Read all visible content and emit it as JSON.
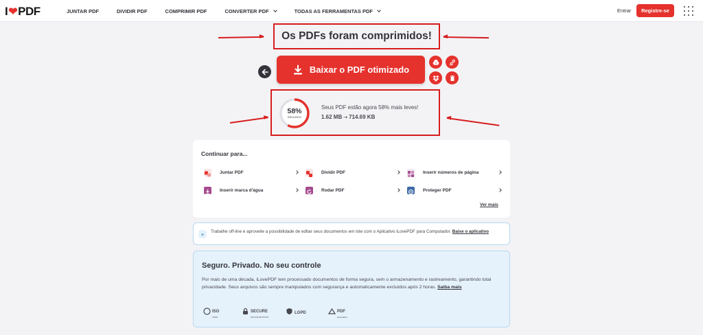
{
  "header": {
    "logo_prefix": "I",
    "logo_suffix": "PDF",
    "nav": [
      "JUNTAR PDF",
      "DIVIDIR PDF",
      "COMPRIMIR PDF",
      "CONVERTER PDF",
      "TODAS AS FERRAMENTAS PDF"
    ],
    "login": "Entrar",
    "signup": "Registre-se"
  },
  "result": {
    "title": "Os PDFs foram comprimidos!",
    "download_label": "Baixar o PDF otimizado"
  },
  "compression": {
    "percent_label": "58%",
    "percent_value": 58,
    "reduced_label": "REDUZIDO",
    "message": "Seus PDF estão agora 58% mais leves!",
    "size_before": "1.62 MB",
    "size_after": "714.69 KB"
  },
  "continue": {
    "title": "Continuar para...",
    "tools": [
      {
        "label": "Juntar PDF",
        "color": "#e5322d"
      },
      {
        "label": "Dividir PDF",
        "color": "#e5322d"
      },
      {
        "label": "Inserir números de página",
        "color": "#a54c8f"
      },
      {
        "label": "Inserir marca d'água",
        "color": "#a54c8f"
      },
      {
        "label": "Rodar PDF",
        "color": "#a54c8f"
      },
      {
        "label": "Proteger PDF",
        "color": "#3b6aa6"
      }
    ],
    "see_more": "Ver mais"
  },
  "desktop_banner": {
    "text": "Trabalhe off-line e aproveite a possibilidade de editar seus documentos em lote com o Aplicativo iLovePDF para Computador.",
    "link": "Baixe o aplicativo"
  },
  "security": {
    "title": "Seguro. Privado. No seu controle",
    "text": "Por mais de uma década, iLovePDF tem processado documentos de forma segura, sem o armazenamento e rastreamento, garantindo total privacidade. Seus arquivos são sempre manipulados com segurança e automaticamente excluídos após 2 horas.",
    "link": "Saiba mais",
    "badges": [
      {
        "label": "ISO",
        "sub": "27001"
      },
      {
        "label": "SECURE",
        "sub": "SSL ENCRYPTION"
      },
      {
        "label": "LGPD",
        "sub": ""
      },
      {
        "label": "PDF",
        "sub": "association"
      }
    ]
  },
  "colors": {
    "accent": "#e5322d",
    "annotation": "#d71c1c"
  }
}
